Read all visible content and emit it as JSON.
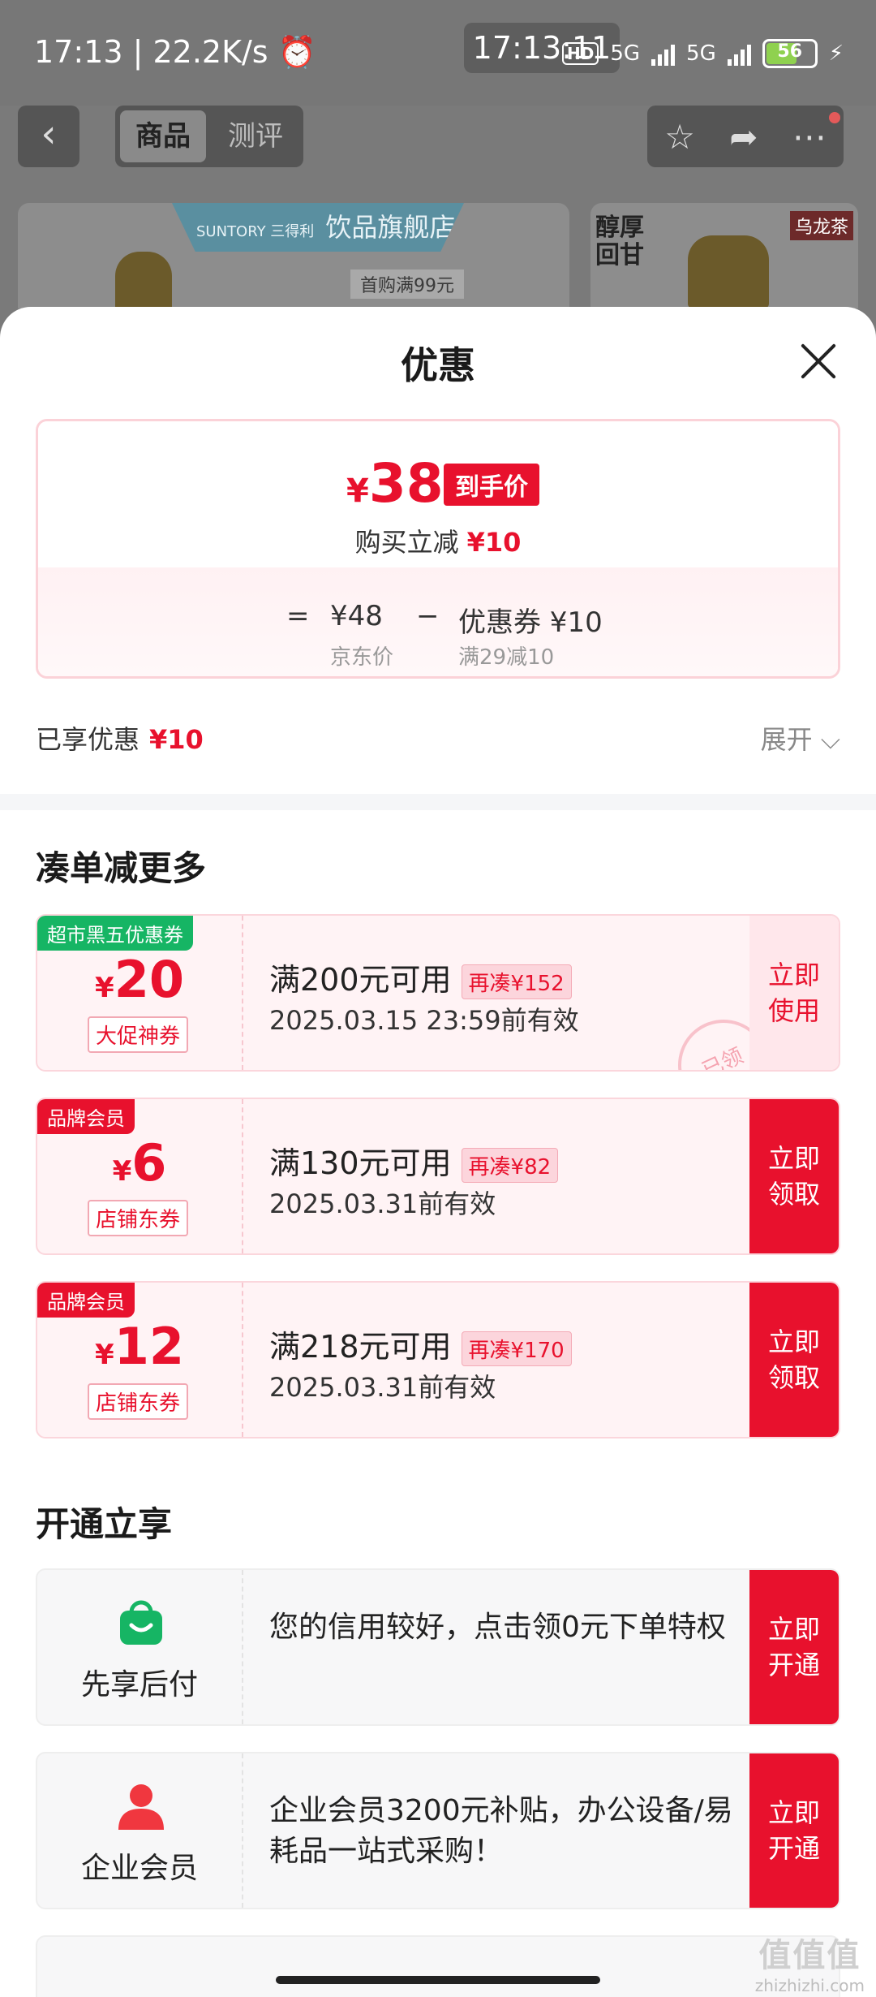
{
  "status_bar": {
    "left": "17:13 | 22.2K/s ⏰",
    "center_time": "17:13:11",
    "hd": "HD",
    "net1": "5G",
    "net2": "5G",
    "battery": "56"
  },
  "top_nav": {
    "back": "‹",
    "tab_goods": "商品",
    "tab_reviews": "测评",
    "star": "☆",
    "share": "➦",
    "more": "⋯"
  },
  "banner": {
    "brand": "SUNTORY 三得利",
    "store": "饮品旗舰店",
    "promo": "首购满99元",
    "slogan": "醇厚\n回甘",
    "logo": "乌龙茶"
  },
  "sheet": {
    "title": "优惠",
    "price": {
      "yen": "¥",
      "final": "38",
      "final_tag": "到手价",
      "reduce_label": "购买立减",
      "reduce_value": "¥10",
      "eq": "=",
      "jd_price": "¥48",
      "jd_price_label": "京东价",
      "minus": "−",
      "coupon_text": "优惠券 ¥10",
      "coupon_rule": "满29减10"
    },
    "enjoyed_label": "已享优惠",
    "enjoyed_value": "¥10",
    "expand": "展开 ⌵",
    "section_more": "凑单减更多",
    "coupons": [
      {
        "label": "超市黑五优惠券",
        "yen": "¥",
        "amount": "20",
        "kind": "大促神券",
        "condition": "满200元可用",
        "need": "再凑¥152",
        "valid": "2025.03.15 23:59前有效",
        "action_line1": "立即",
        "action_line2": "使用",
        "stamp": "已领"
      },
      {
        "label": "品牌会员",
        "yen": "¥",
        "amount": "6",
        "kind": "店铺东券",
        "condition": "满130元可用",
        "need": "再凑¥82",
        "valid": "2025.03.31前有效",
        "action_line1": "立即",
        "action_line2": "领取"
      },
      {
        "label": "品牌会员",
        "yen": "¥",
        "amount": "12",
        "kind": "店铺东券",
        "condition": "满218元可用",
        "need": "再凑¥170",
        "valid": "2025.03.31前有效",
        "action_line1": "立即",
        "action_line2": "领取"
      }
    ],
    "section_open": "开通立享",
    "services": [
      {
        "name": "先享后付",
        "desc": "您的信用较好，点击领0元下单特权",
        "action_line1": "立即",
        "action_line2": "开通",
        "icon_color": "#16b564"
      },
      {
        "name": "企业会员",
        "desc": "企业会员3200元补贴，办公设备/易耗品一站式采购！",
        "action_line1": "立即",
        "action_line2": "开通",
        "icon_color": "#f0373f"
      }
    ]
  },
  "watermark": {
    "line1": "值值值",
    "line2": "zhizhizhi.com"
  },
  "colors": {
    "accent": "#e8112d",
    "green": "#16b564"
  }
}
